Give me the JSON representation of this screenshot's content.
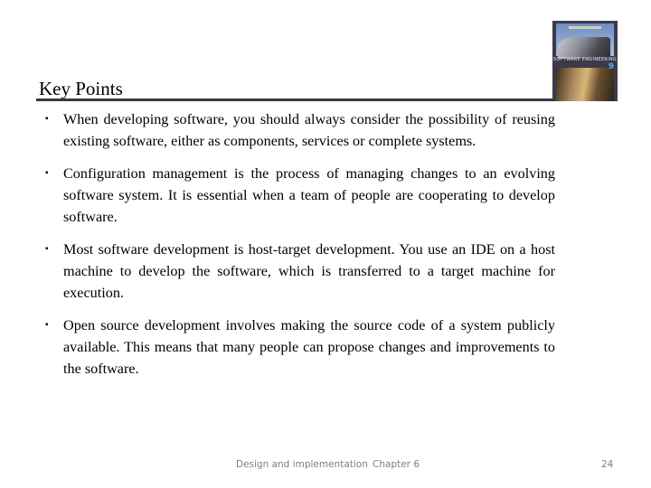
{
  "slide": {
    "title": "Key Points",
    "bullet_marker": "▪",
    "bullets": [
      "When developing software, you should always consider the possibility of reusing existing software, either as components, services or complete systems.",
      "Configuration management is the process of managing changes to an evolving software system. It is essential when a team of people are cooperating to develop software.",
      "Most software development is host-target development. You use an IDE on a host machine to develop the software, which is transferred to a target machine for execution.",
      "Open source development involves making the source code of a system publicly available.  This means that many people can propose changes and improvements to the software."
    ],
    "cover": {
      "title": "SOFTWARE ENGINEERING",
      "edition": "9"
    }
  },
  "footer": {
    "section": "Design and implementation",
    "chapter": "Chapter 6",
    "page_number": "24"
  }
}
